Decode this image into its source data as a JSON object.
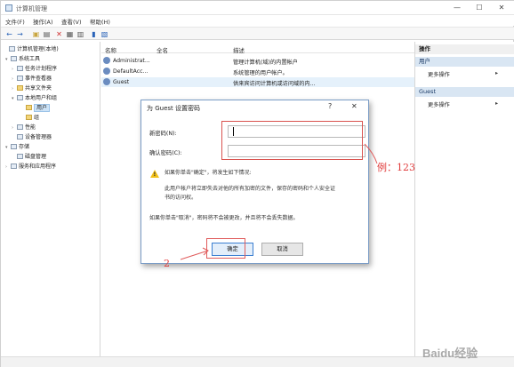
{
  "window": {
    "title": "计算机管理",
    "minimize_glyph": "—",
    "maximize_glyph": "☐",
    "close_glyph": "✕"
  },
  "menu": [
    "文件(F)",
    "操作(A)",
    "查看(V)",
    "帮助(H)"
  ],
  "toolbar": {
    "icons": [
      "back-arrow-icon",
      "forward-arrow-icon",
      "up-folder-icon",
      "properties-icon",
      "delete-icon",
      "refresh-icon",
      "export-icon",
      "help-icon",
      "view-icon"
    ]
  },
  "tree": {
    "items": [
      {
        "label": "计算机管理(本地)",
        "expander": "",
        "icon": "computer-icon",
        "selected": false
      },
      {
        "label": "系统工具",
        "expander": "▾",
        "icon": "tools-icon",
        "selected": false
      },
      {
        "label": "任务计划程序",
        "expander": "›",
        "icon": "clock-icon",
        "selected": false
      },
      {
        "label": "事件查看器",
        "expander": "›",
        "icon": "event-log-icon",
        "selected": false
      },
      {
        "label": "共享文件夹",
        "expander": "›",
        "icon": "share-folder-icon",
        "selected": false
      },
      {
        "label": "本地用户和组",
        "expander": "▾",
        "icon": "users-icon",
        "selected": false
      },
      {
        "label": "用户",
        "expander": "",
        "icon": "folder-icon",
        "selected": true
      },
      {
        "label": "组",
        "expander": "",
        "icon": "folder-icon",
        "selected": false
      },
      {
        "label": "性能",
        "expander": "›",
        "icon": "performance-icon",
        "selected": false
      },
      {
        "label": "设备管理器",
        "expander": "",
        "icon": "device-manager-icon",
        "selected": false
      },
      {
        "label": "存储",
        "expander": "▾",
        "icon": "storage-icon",
        "selected": false
      },
      {
        "label": "磁盘管理",
        "expander": "",
        "icon": "disk-icon",
        "selected": false
      },
      {
        "label": "服务和应用程序",
        "expander": "›",
        "icon": "services-icon",
        "selected": false
      }
    ]
  },
  "list": {
    "columns": [
      "名称",
      "全名",
      "描述"
    ],
    "rows": [
      {
        "name": "Administrat...",
        "fullname": "",
        "desc": "管理计算机(域)的内置帐户"
      },
      {
        "name": "DefaultAcc...",
        "fullname": "",
        "desc": "系统管理的用户帐户。"
      },
      {
        "name": "Guest",
        "fullname": "",
        "desc": "供来宾访问计算机或访问域的内..."
      }
    ]
  },
  "actions": {
    "header": "操作",
    "sections": [
      {
        "title": "用户",
        "items": [
          "更多操作"
        ]
      },
      {
        "title": "Guest",
        "items": [
          "更多操作"
        ]
      }
    ]
  },
  "dialog": {
    "title": "为 Guest 设置密码",
    "help_glyph": "?",
    "close_glyph": "✕",
    "new_password_label": "新密码(N):",
    "confirm_password_label": "确认密码(C):",
    "new_password_value": "",
    "confirm_password_value": "",
    "warning_intro": "如果你单击\"确定\"，将发生如下情况:",
    "warning_body_1": "此用户帐户将立即失去对他的所有加密的文件，保存的密码和个人安全证",
    "warning_body_2": "书的访问权。",
    "cancel_note": "如果你单击\"取消\"，密码将不会被更改，并且将不会丢失数据。",
    "ok_label": "确定",
    "cancel_label": "取消"
  },
  "annotations": {
    "example": "例：123",
    "step": "2",
    "color": "#e03a3a"
  },
  "watermark": "Baidu经验"
}
